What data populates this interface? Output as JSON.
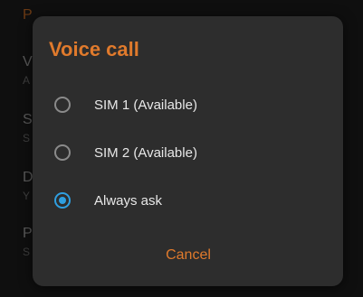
{
  "dialog": {
    "title": "Voice call",
    "options": [
      {
        "label": "SIM 1 (Available)",
        "selected": false
      },
      {
        "label": "SIM 2 (Available)",
        "selected": false
      },
      {
        "label": "Always ask",
        "selected": true
      }
    ],
    "cancel_label": "Cancel"
  },
  "colors": {
    "accent": "#e07a2c",
    "radio_selected": "#2f9fe0",
    "dialog_bg": "#2d2d2d"
  }
}
